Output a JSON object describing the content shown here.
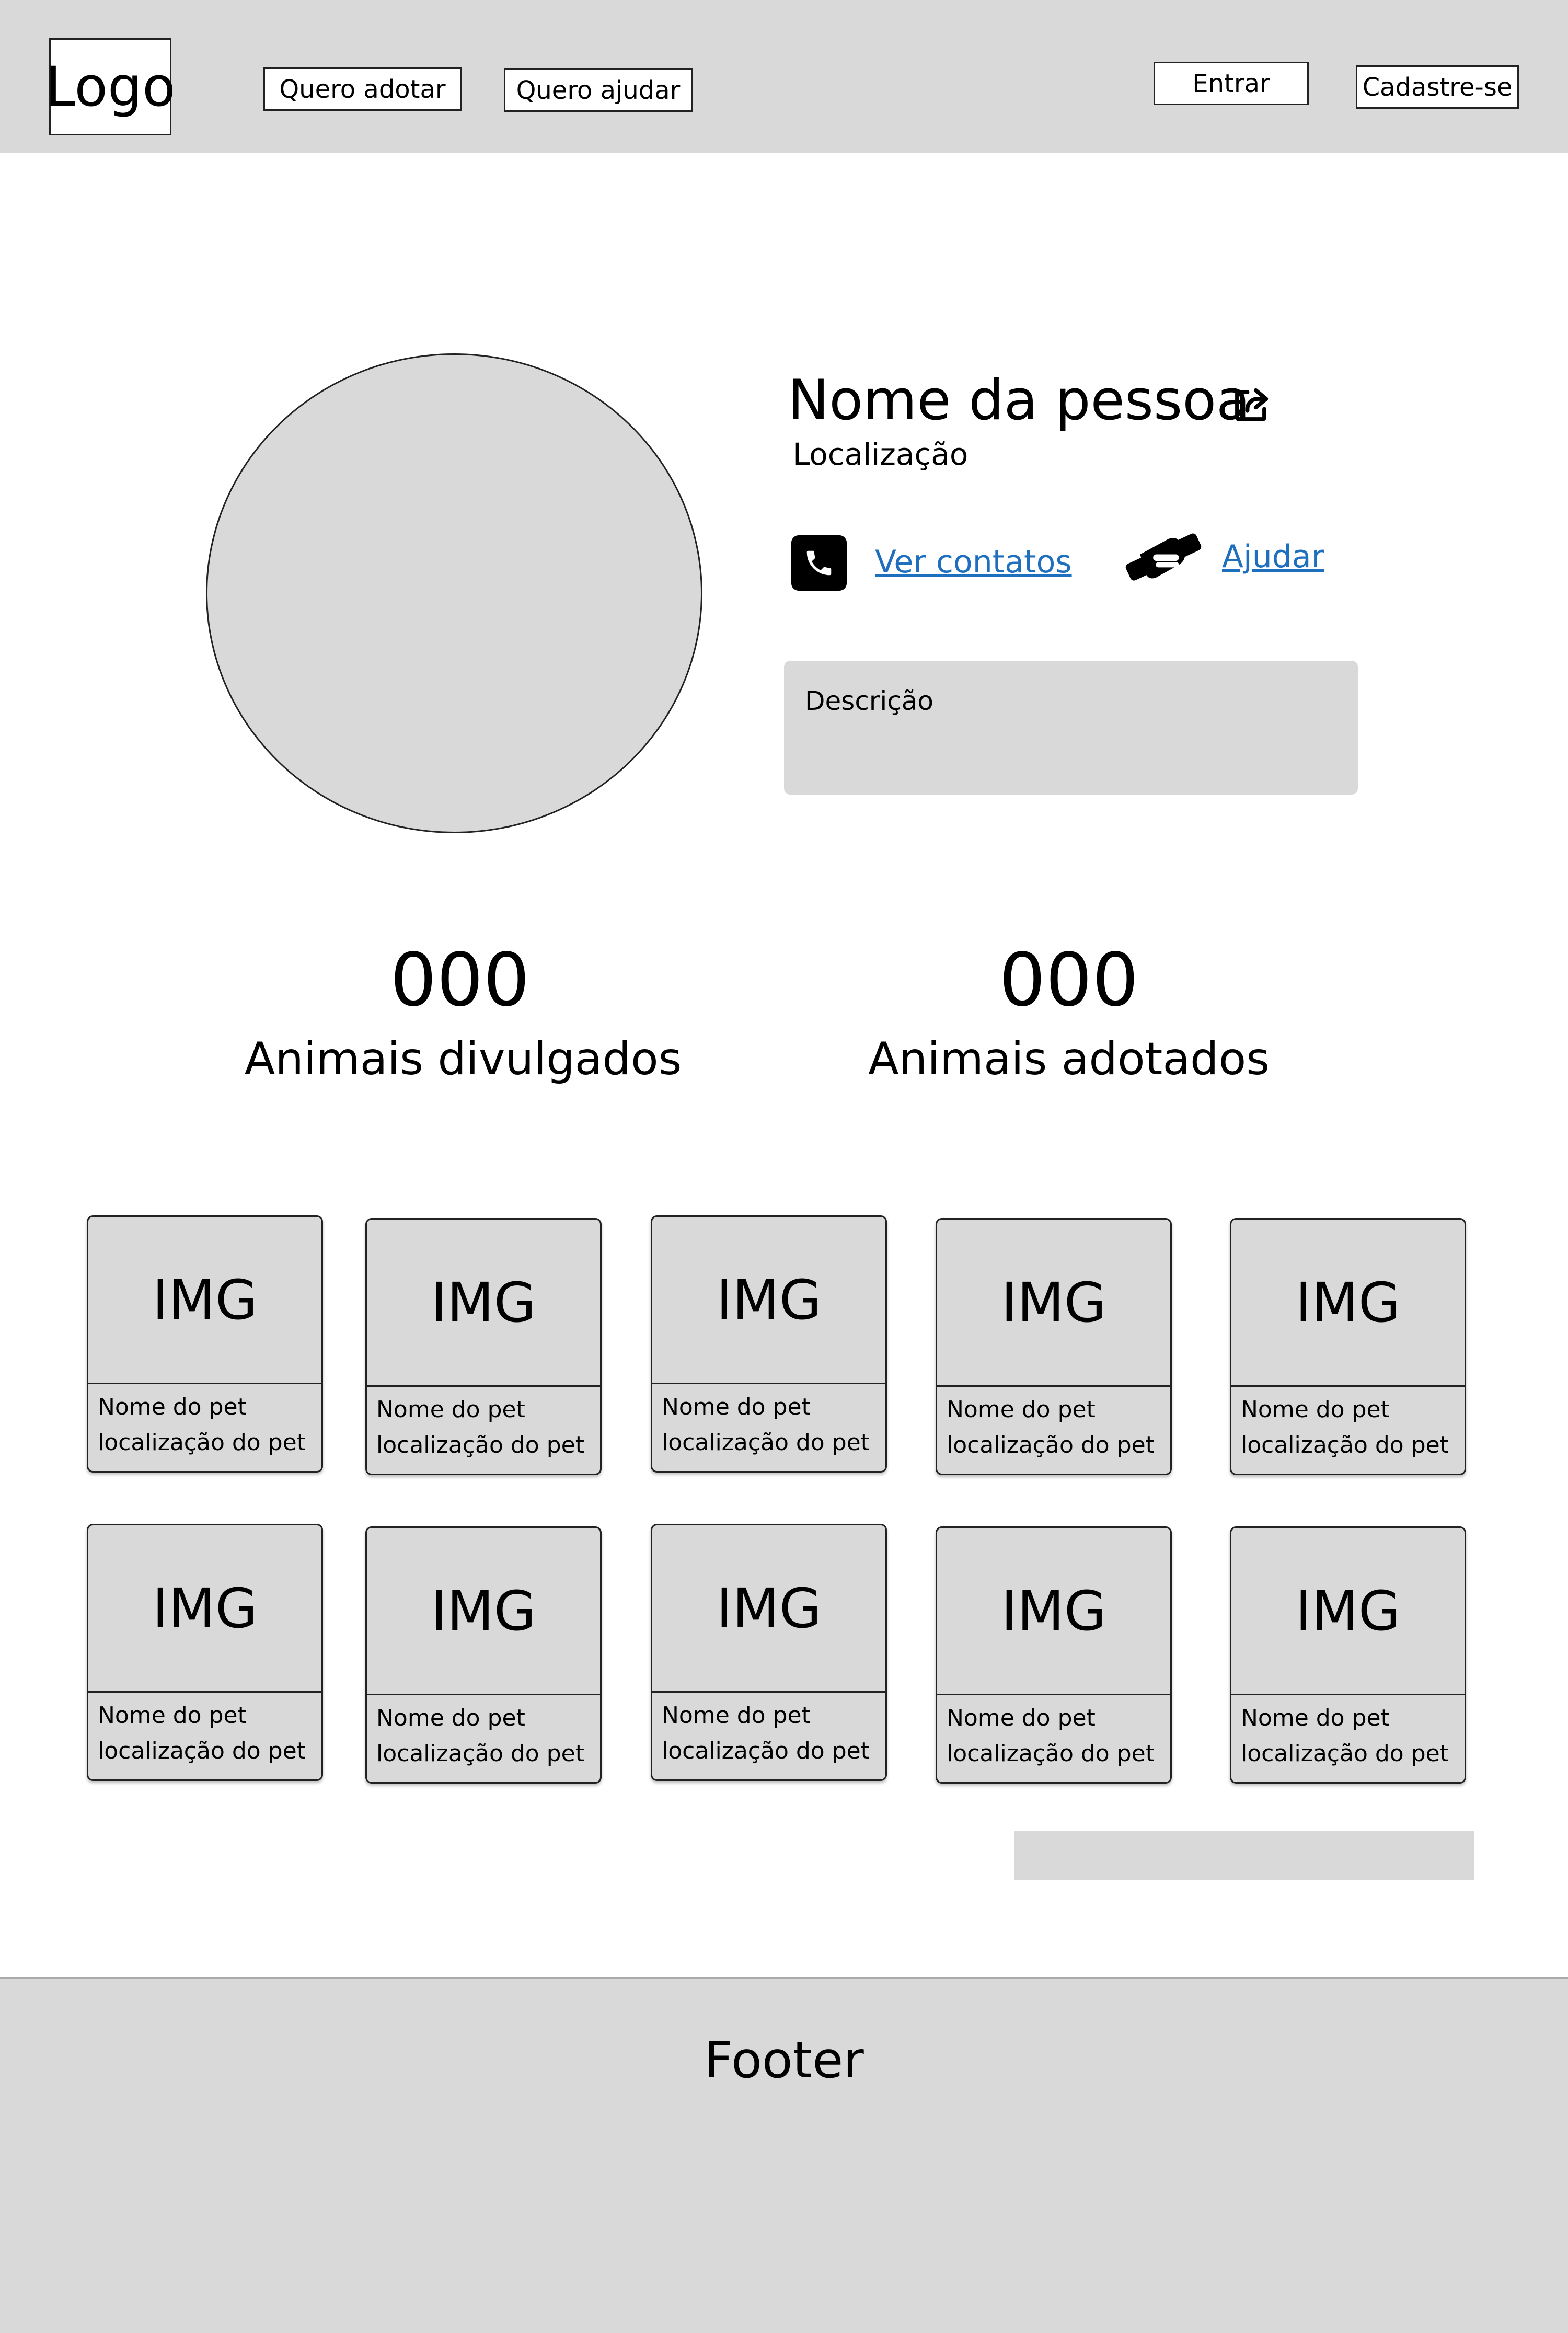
{
  "header": {
    "logo": "Logo",
    "nav": [
      "Quero adotar",
      "Quero ajudar"
    ],
    "auth": [
      "Entrar",
      "Cadastre-se"
    ]
  },
  "profile": {
    "name": "Nome da pessoa",
    "location": "Localização",
    "contacts_link": "Ver contatos",
    "help_link": "Ajudar",
    "description": "Descrição"
  },
  "stats": [
    {
      "value": "000",
      "label": "Animais divulgados"
    },
    {
      "value": "000",
      "label": "Animais adotados"
    }
  ],
  "pets": [
    {
      "img": "IMG",
      "name": "Nome do pet",
      "location": "localização do pet"
    },
    {
      "img": "IMG",
      "name": "Nome do pet",
      "location": "localização do pet"
    },
    {
      "img": "IMG",
      "name": "Nome do pet",
      "location": "localização do pet"
    },
    {
      "img": "IMG",
      "name": "Nome do pet",
      "location": "localização do pet"
    },
    {
      "img": "IMG",
      "name": "Nome do pet",
      "location": "localização do pet"
    },
    {
      "img": "IMG",
      "name": "Nome do pet",
      "location": "localização do pet"
    },
    {
      "img": "IMG",
      "name": "Nome do pet",
      "location": "localização do pet"
    },
    {
      "img": "IMG",
      "name": "Nome do pet",
      "location": "localização do pet"
    },
    {
      "img": "IMG",
      "name": "Nome do pet",
      "location": "localização do pet"
    },
    {
      "img": "IMG",
      "name": "Nome do pet",
      "location": "localização do pet"
    }
  ],
  "footer": {
    "text": "Footer"
  },
  "icons": {
    "share": "share-icon",
    "phone": "phone-icon",
    "help": "handshake-icon"
  },
  "colors": {
    "link": "#1f6fbf",
    "placeholder": "#d9d9d9"
  }
}
